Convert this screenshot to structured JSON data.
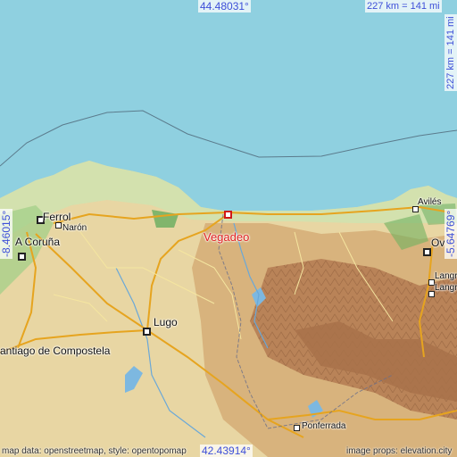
{
  "map": {
    "bounds": {
      "north": "44.48031°",
      "south": "42.43914°",
      "west": "-8.46015°",
      "east": "-5.64769°"
    },
    "scale": "227 km = 141 mi",
    "colors": {
      "sea": "#8fd0e0",
      "lowland": "#cfe3b0",
      "plains": "#e8d6a3",
      "hills": "#d8b37d",
      "mountains": "#a8724a"
    },
    "selected_place": "Vegadeo",
    "places": [
      {
        "id": "ferrol",
        "name": "Ferrol"
      },
      {
        "id": "naron",
        "name": "Narón"
      },
      {
        "id": "coruna",
        "name": "A Coruña"
      },
      {
        "id": "vegadeo",
        "name": "Vegadeo"
      },
      {
        "id": "lugo",
        "name": "Lugo"
      },
      {
        "id": "santiago",
        "name": "antiago de Compostela"
      },
      {
        "id": "aviles",
        "name": "Avilés"
      },
      {
        "id": "oviedo",
        "name": "Ov"
      },
      {
        "id": "langreo1",
        "name": "Langr"
      },
      {
        "id": "langreo2",
        "name": "Langr"
      },
      {
        "id": "ponferrada",
        "name": "Ponferrada"
      }
    ],
    "credits": {
      "left": "map data: openstreetmap, style: opentopomap",
      "right": "image props: elevation.city"
    }
  }
}
